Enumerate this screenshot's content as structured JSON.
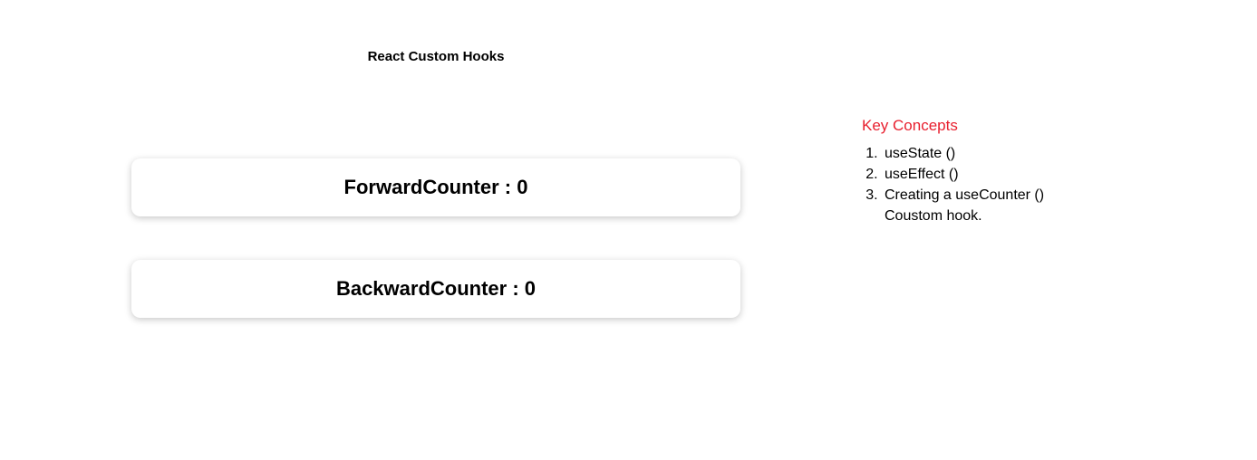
{
  "header": {
    "title": "React Custom Hooks"
  },
  "counters": [
    {
      "label": "ForwardCounter",
      "separator": " : ",
      "value": "0"
    },
    {
      "label": "BackwardCounter",
      "separator": " : ",
      "value": "0"
    }
  ],
  "concepts": {
    "title": "Key Concepts",
    "items": [
      "useState ()",
      "useEffect ()",
      "Creating a useCounter () Coustom hook."
    ]
  },
  "colors": {
    "accent": "#e8202f",
    "card_background": "#ffffff"
  }
}
